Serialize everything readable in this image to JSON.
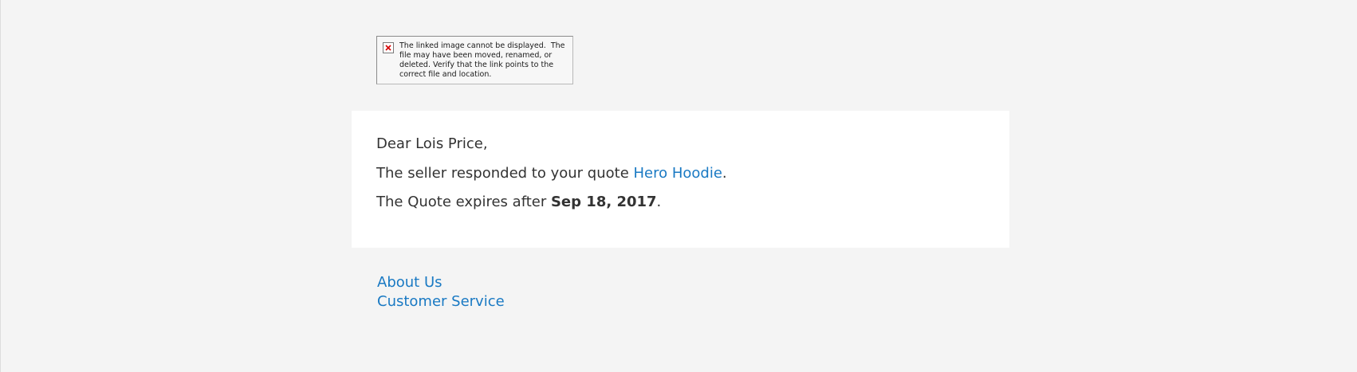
{
  "broken_image": {
    "icon": "broken-image-icon",
    "message": "The linked image cannot be displayed.  The file may have been moved, renamed, or deleted. Verify that the link points to the correct file and location."
  },
  "email": {
    "greeting": "Dear Lois Price,",
    "response_prefix": "The seller responded to your quote ",
    "quote_name": "Hero Hoodie",
    "response_suffix": ".",
    "expiry_prefix": "The Quote expires after ",
    "expiry_date": "Sep 18, 2017",
    "expiry_suffix": "."
  },
  "footer": {
    "links": [
      "About Us",
      "Customer Service"
    ]
  },
  "colors": {
    "page_background": "#f4f4f4",
    "card_background": "#ffffff",
    "text": "#333333",
    "link": "#1979c3",
    "error_icon": "#d40000"
  }
}
